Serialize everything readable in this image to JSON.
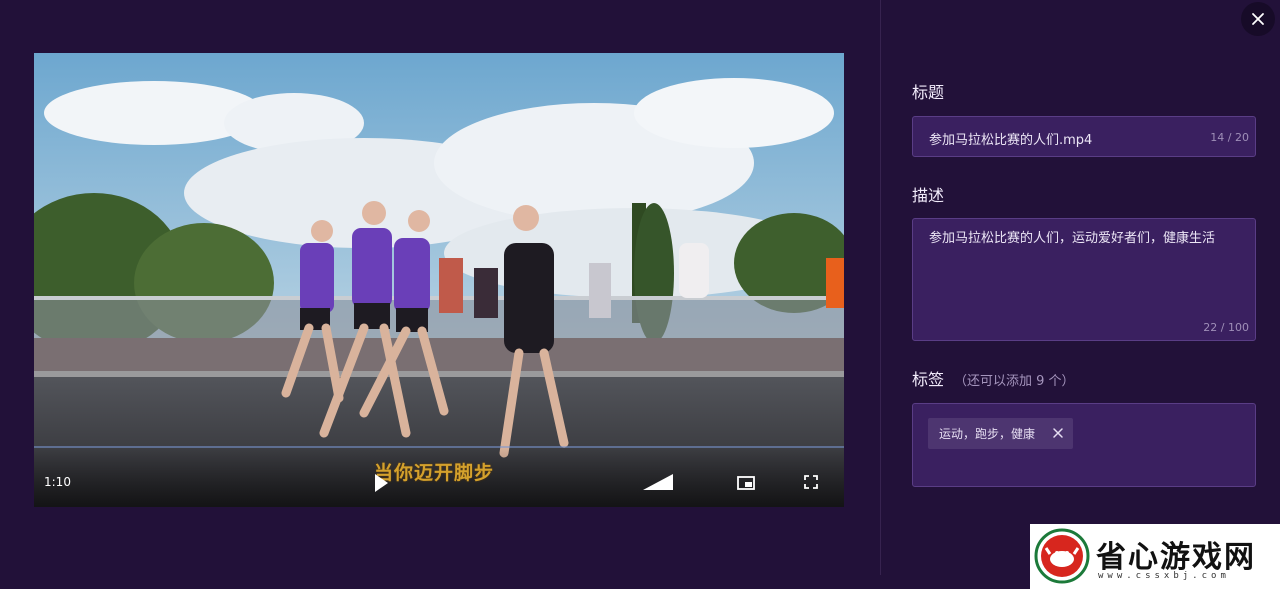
{
  "player": {
    "current_time": "1:10",
    "progress": 0.0,
    "subtitle": "当你迈开脚步"
  },
  "panel": {
    "title_label": "标题",
    "title_value": "参加马拉松比赛的人们.mp4",
    "title_counter": "14 / 20",
    "desc_label": "描述",
    "desc_value": "参加马拉松比赛的人们，运动爱好者们，健康生活",
    "desc_counter": "22 / 100",
    "tags_label": "标签",
    "tags_hint": "（还可以添加 9 个）",
    "tags": [
      "运动，跑步，健康"
    ]
  },
  "watermark": {
    "name": "省心游戏网",
    "url": "www.cssxbj.com"
  },
  "icons": {
    "close": "close-icon",
    "play": "play-icon",
    "volume": "volume-icon",
    "pip": "picture-in-picture-icon",
    "fullscreen": "fullscreen-icon",
    "tag_remove": "close-icon"
  },
  "colors": {
    "background": "#221139",
    "field_bg": "#3a2060",
    "subtitle": "#d4a12c"
  }
}
